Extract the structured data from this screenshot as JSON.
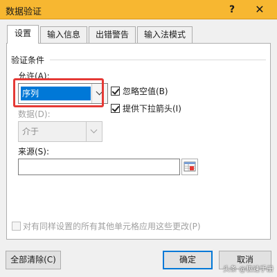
{
  "window": {
    "title": "数据验证",
    "help": "?",
    "close": "✕"
  },
  "tabs": [
    {
      "label": "设置",
      "active": true
    },
    {
      "label": "输入信息",
      "active": false
    },
    {
      "label": "出错警告",
      "active": false
    },
    {
      "label": "输入法模式",
      "active": false
    }
  ],
  "settings": {
    "group_label": "验证条件",
    "allow_label": "允许(A):",
    "allow_value": "序列",
    "ignore_blank_label": "忽略空值(B)",
    "ignore_blank_checked": true,
    "dropdown_label": "提供下拉箭头(I)",
    "dropdown_checked": true,
    "data_label": "数据(D):",
    "data_value": "介于",
    "source_label": "来源(S):",
    "source_value": "",
    "apply_all_label": "对有同样设置的所有其他单元格应用这些更改(P)",
    "apply_all_checked": false
  },
  "buttons": {
    "clear_all": "全部清除(C)",
    "ok": "确定",
    "cancel": "取消"
  },
  "watermark": "头条 @极速手册",
  "colors": {
    "titlebar": "#f7b731",
    "accent": "#0078d7",
    "highlight": "#e53935"
  },
  "icons": {
    "range_selector": "range-select-icon",
    "chevron": "chevron-down-icon"
  }
}
